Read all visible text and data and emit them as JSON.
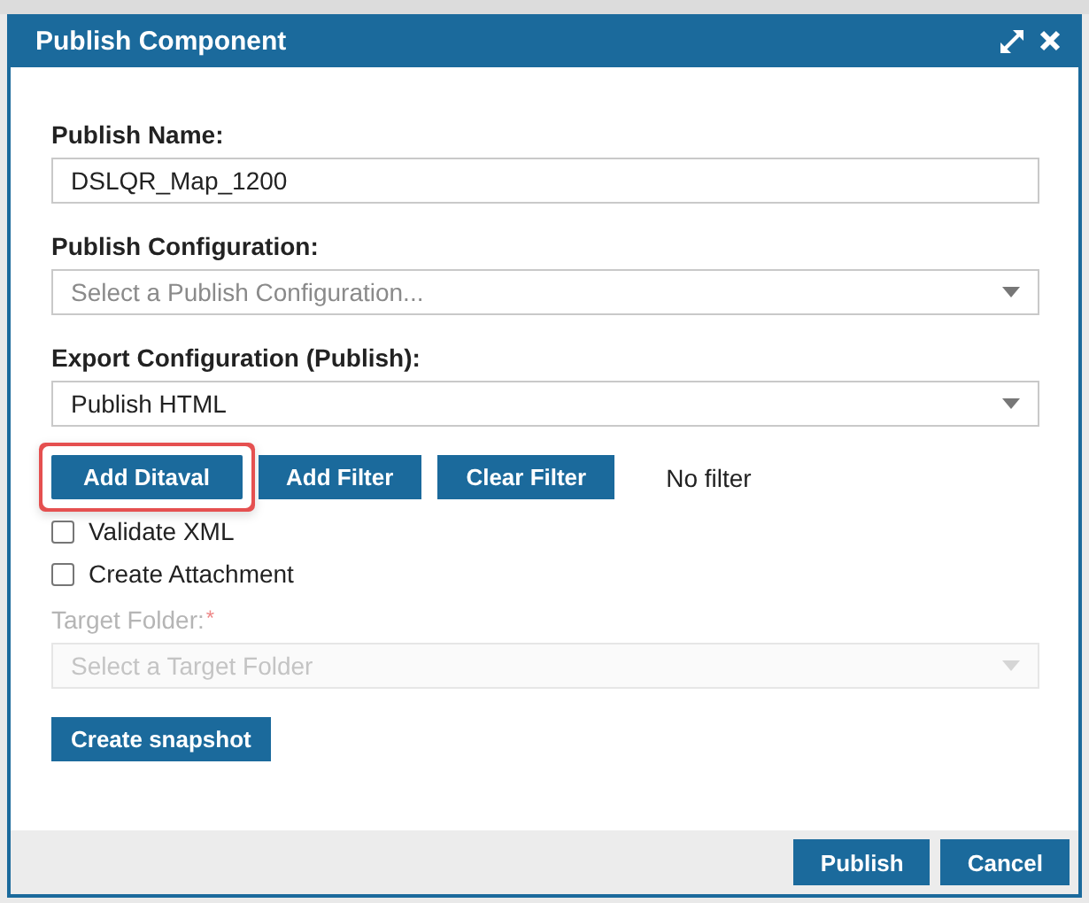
{
  "dialog": {
    "title": "Publish Component"
  },
  "fields": [
    {
      "kind": "text",
      "label": "Publish Name:",
      "value": "DSLQR_Map_1200",
      "disabled": false
    },
    {
      "kind": "select",
      "label": "Publish Configuration:",
      "placeholder": "Select a Publish Configuration...",
      "disabled": false
    },
    {
      "kind": "select",
      "label": "Export Configuration (Publish):",
      "value": "Publish HTML",
      "disabled": false
    }
  ],
  "filter_buttons": [
    {
      "label": "Add Ditaval",
      "highlighted": true
    },
    {
      "label": "Add Filter",
      "highlighted": false
    },
    {
      "label": "Clear Filter",
      "highlighted": false
    }
  ],
  "filter_status": "No filter",
  "options": [
    {
      "label": "Validate XML",
      "checked": false
    },
    {
      "label": "Create Attachment",
      "checked": false
    }
  ],
  "target_folder": {
    "kind": "select",
    "label": "Target Folder:",
    "required_mark": "*",
    "placeholder": "Select a Target Folder",
    "disabled": true
  },
  "snapshot_button": "Create snapshot",
  "footer_buttons": [
    "Publish",
    "Cancel"
  ]
}
